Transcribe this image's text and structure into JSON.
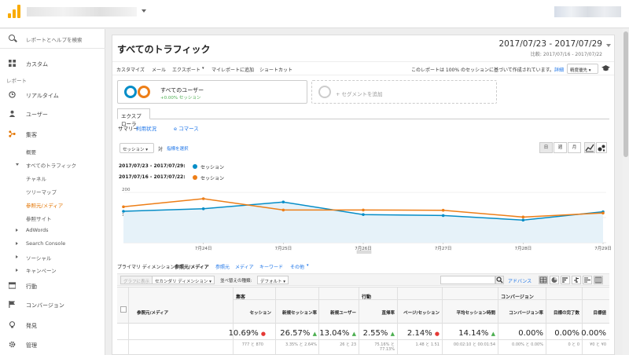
{
  "sidebar": {
    "search_placeholder": "レポートとヘルプを検索",
    "custom": "カスタム",
    "report_section": "レポート",
    "realtime": "リアルタイム",
    "users": "ユーザー",
    "acquisition": "集客",
    "overview": "概要",
    "all_traffic": "すべてのトラフィック",
    "channels": "チャネル",
    "treemap": "ツリーマップ",
    "source_medium": "参照元/メディア",
    "referrals": "参照サイト",
    "adwords": "AdWords",
    "search_console": "Search Console",
    "social": "ソーシャル",
    "campaigns": "キャンペーン",
    "behavior": "行動",
    "conversions": "コンバージョン",
    "discover": "発見",
    "admin": "管理"
  },
  "main": {
    "title": "すべてのトラフィック",
    "date_range": "2017/07/23 - 2017/07/29",
    "compare_range": "比較: 2017/07/16 - 2017/07/22",
    "toolbar": {
      "customize": "カスタマイズ",
      "email": "メール",
      "export": "エクスポート",
      "add_dashboard": "マイレポートに追加",
      "shortcut": "ショートカット",
      "note": "このレポートは 100% のセッションに基づいて作成されています。",
      "details": "詳細",
      "precision": "精度優先"
    },
    "segment": {
      "name": "すべてのユーザー",
      "pct": "+0.00% セッション",
      "add": "+ セグメントを追加"
    },
    "explorer_tab": "エクスプローラ",
    "subtabs": [
      "サマリー",
      "利用状況",
      "e コマース"
    ],
    "metric": "セッション",
    "vs": "対",
    "pick_metric": "指標を選択",
    "granularity": [
      "日",
      "週",
      "月"
    ],
    "legend": [
      {
        "range": "2017/07/23 - 2017/07/29:",
        "label": "セッション",
        "color": "#058dc7"
      },
      {
        "range": "2017/07/16 - 2017/07/22:",
        "label": "セッション",
        "color": "#ed7e17"
      }
    ],
    "dimensions": {
      "primary_label": "プライマリ ディメンション:",
      "active": "参照元/メディア",
      "items": [
        "参照元",
        "メディア",
        "キーワード",
        "その他"
      ]
    },
    "controls": {
      "plot_rows": "グラフに表示",
      "secondary": "セカンダリ ディメンション",
      "sort_label": "並べ替えの種類:",
      "sort_value": "デフォルト",
      "advanced": "アドバンス"
    },
    "table": {
      "dimension_header": "参照元/メディア",
      "groups": [
        "集客",
        "行動",
        "コンバージョン"
      ],
      "columns": [
        "セッション",
        "新規セッション率",
        "新規ユーザー",
        "直帰率",
        "ページ/セッション",
        "平均セッション時間",
        "コンバージョン率",
        "目標の完了数",
        "目標値"
      ],
      "totals": [
        "10.69%",
        "26.57%",
        "13.04%",
        "2.55%",
        "2.14%",
        "14.14%",
        "0.00%",
        "0.00%",
        "0.00%"
      ],
      "totals_sub": [
        "777 と 870",
        "3.35% と 2.64%",
        "26 と 23",
        "75.16% と 77.13%",
        "1.48 と 1.51",
        "00:02:10 と 00:01:54",
        "0.00% と 0.00%",
        "0 と 0",
        "¥0 と ¥0"
      ]
    }
  },
  "chart_data": {
    "type": "line",
    "categories": [
      "7月23日",
      "7月24日",
      "7月25日",
      "7月26日",
      "7月27日",
      "7月28日",
      "7月29日"
    ],
    "x_tick_labels": [
      "7月24日",
      "7月25日",
      "7月26日",
      "7月27日",
      "7月28日",
      "7月29日"
    ],
    "ylim": [
      0,
      200
    ],
    "y_ticks": [
      100,
      200
    ],
    "series": [
      {
        "name": "2017/07/23 - 2017/07/29: セッション",
        "color": "#058dc7",
        "values": [
          125,
          135,
          162,
          112,
          108,
          90,
          123
        ],
        "area": true
      },
      {
        "name": "2017/07/16 - 2017/07/22: セッション",
        "color": "#ed7e17",
        "values": [
          143,
          175,
          130,
          130,
          129,
          102,
          118
        ],
        "area": false
      }
    ]
  }
}
